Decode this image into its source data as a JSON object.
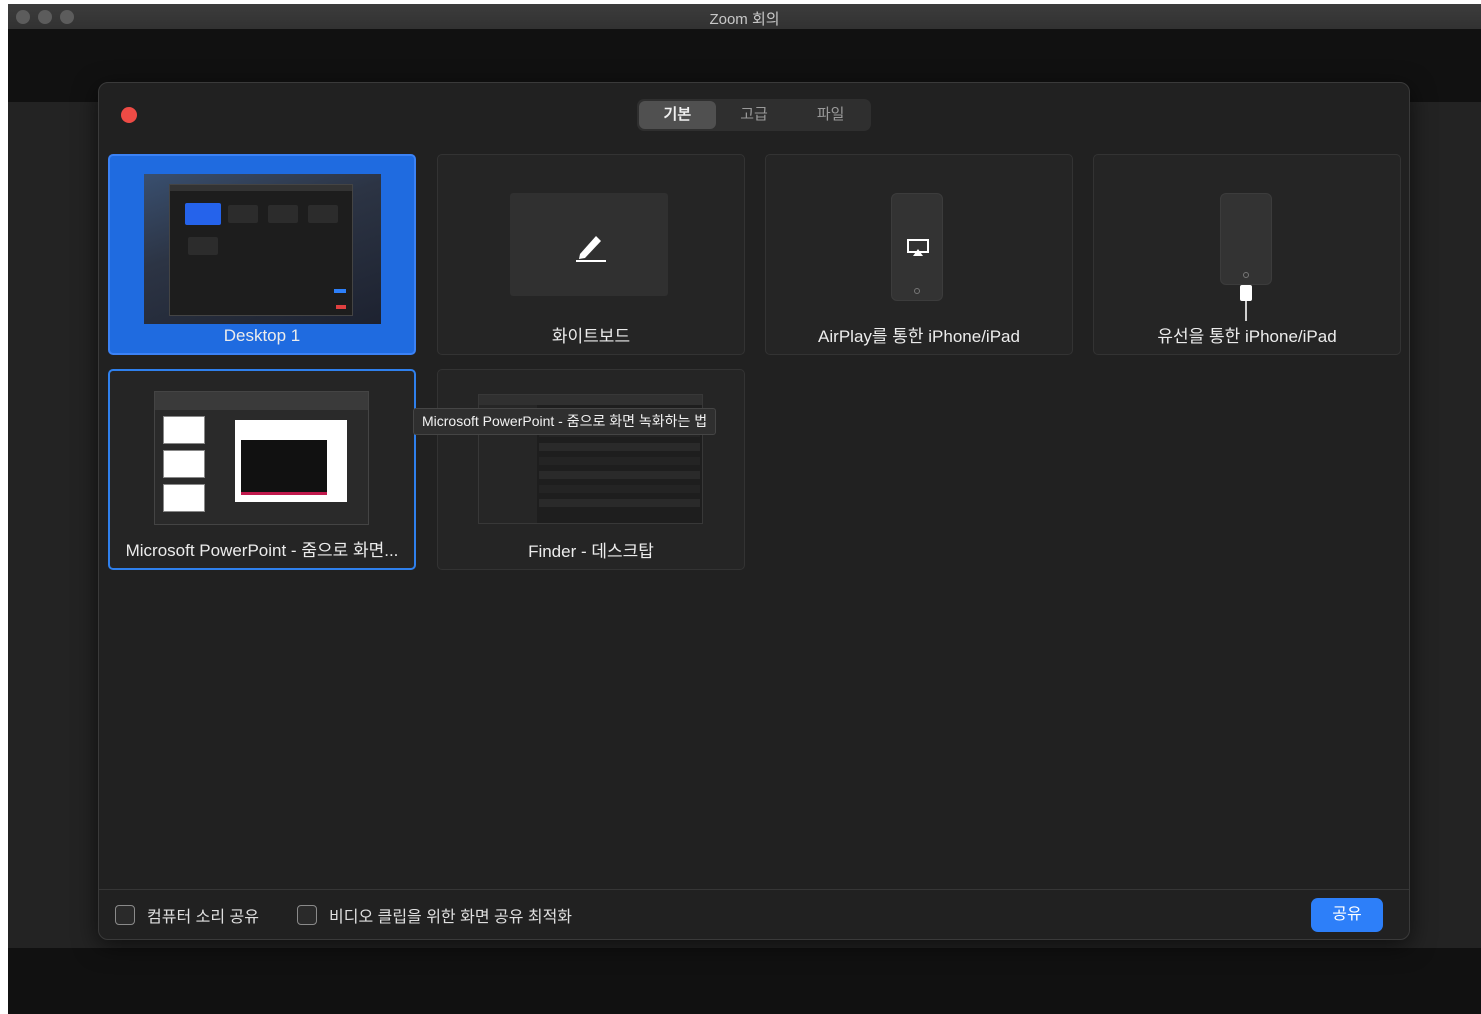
{
  "window": {
    "title": "Zoom 회의"
  },
  "tabs": [
    {
      "label": "기본",
      "active": true
    },
    {
      "label": "고급",
      "active": false
    },
    {
      "label": "파일",
      "active": false
    }
  ],
  "sources": [
    {
      "label": "Desktop 1",
      "selected": true
    },
    {
      "label": "화이트보드"
    },
    {
      "label": "AirPlay를 통한 iPhone/iPad"
    },
    {
      "label": "유선을 통한 iPhone/iPad"
    },
    {
      "label": "Microsoft PowerPoint - 줌으로 화면..."
    },
    {
      "label": "Finder - 데스크탑"
    }
  ],
  "tooltip": {
    "text": "Microsoft PowerPoint - 줌으로 화면 녹화하는 법"
  },
  "options": {
    "share_sound": "컴퓨터 소리 공유",
    "optimize_video": "비디오 클립을 위한 화면 공유 최적화"
  },
  "share_button": "공유",
  "icons": {
    "whiteboard": "pencil-icon",
    "airplay": "airplay-icon",
    "wired": "cable-icon"
  },
  "colors": {
    "accent": "#2d7ff9",
    "close": "#ee4b45"
  }
}
